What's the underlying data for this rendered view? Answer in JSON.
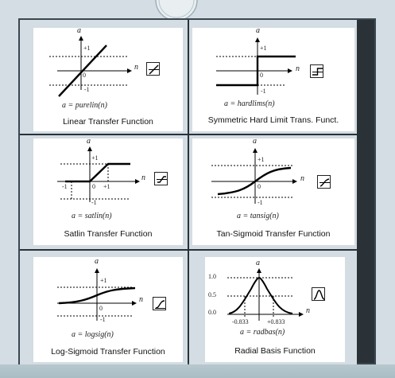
{
  "cells": [
    {
      "caption": "Linear Transfer Function",
      "formula": "a = purelin(n)",
      "axis_a": "a",
      "axis_n": "n",
      "tick_pos": "+1",
      "tick_neg": "-1",
      "origin": "0",
      "icon": "linear-icon"
    },
    {
      "caption": "Symmetric Hard Limit Trans. Funct.",
      "formula": "a = hardlims(n)",
      "axis_a": "a",
      "axis_n": "n",
      "tick_pos": "+1",
      "tick_neg": "-1",
      "origin": "0",
      "icon": "hard-limit-icon"
    },
    {
      "caption": "Satlin Transfer Function",
      "formula": "a = satlin(n)",
      "axis_a": "a",
      "axis_n": "n",
      "tick_pos": "+1",
      "tick_neg": "-1",
      "origin": "0",
      "x_neg": "-1",
      "x_pos": "+1",
      "icon": "satlin-icon"
    },
    {
      "caption": "Tan-Sigmoid Transfer Function",
      "formula": "a = tansig(n)",
      "axis_a": "a",
      "axis_n": "n",
      "tick_pos": "+1",
      "tick_neg": "-1",
      "origin": "0",
      "icon": "tansig-icon"
    },
    {
      "caption": "Log-Sigmoid Transfer Function",
      "formula": "a = logsig(n)",
      "axis_a": "a",
      "axis_n": "n",
      "tick_pos": "+1",
      "tick_neg": "-1",
      "origin": "0",
      "icon": "logsig-icon"
    },
    {
      "caption": "Radial Basis Function",
      "formula": "a = radbas(n)",
      "axis_a": "a",
      "axis_n": "n",
      "y_top": "1.0",
      "y_mid": "0.5",
      "y_zero": "0.0",
      "x_neg": "-0.833",
      "x_pos": "+0.833",
      "icon": "radbas-icon"
    }
  ]
}
